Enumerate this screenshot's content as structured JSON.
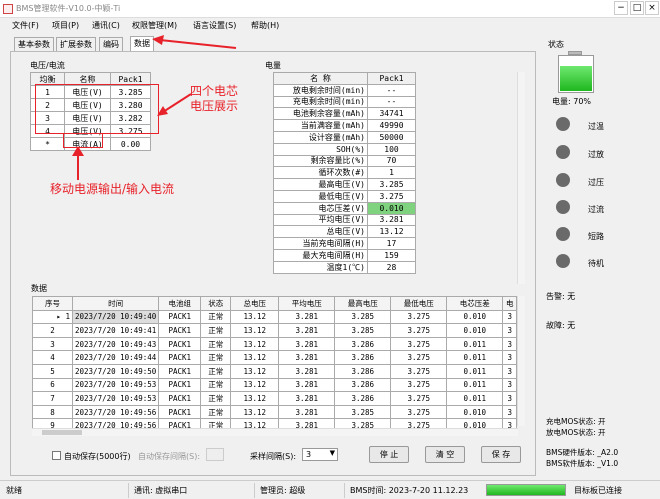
{
  "window": {
    "title": "BMS管理软件-V10.0-中颖-Ti"
  },
  "menu": [
    "文件(F)",
    "项目(P)",
    "通讯(C)",
    "权限管理(M)",
    "语言设置(S)",
    "帮助(H)"
  ],
  "tabs": [
    "基本参数",
    "扩展参数",
    "编码",
    "数据"
  ],
  "cells_section": {
    "title": "电压/电流",
    "headers": [
      "均衡",
      "名称",
      "Pack1"
    ],
    "rows": [
      [
        "1",
        "电压(V)",
        "3.285"
      ],
      [
        "2",
        "电压(V)",
        "3.280"
      ],
      [
        "3",
        "电压(V)",
        "3.282"
      ],
      [
        "4",
        "电压(V)",
        "3.275"
      ],
      [
        "*",
        "电流(A)",
        "0.00"
      ]
    ]
  },
  "quantity_section": {
    "title": "电量",
    "headers": [
      "名 称",
      "Pack1"
    ],
    "rows": [
      [
        "放电剩余时间(min)",
        "--"
      ],
      [
        "充电剩余时间(min)",
        "--"
      ],
      [
        "电池剩余容量(mAh)",
        "34741"
      ],
      [
        "当前满容量(mAh)",
        "49990"
      ],
      [
        "设计容量(mAh)",
        "50000"
      ],
      [
        "SOH(%)",
        "100"
      ],
      [
        "剩余容量比(%)",
        "70"
      ],
      [
        "循环次数(#)",
        "1"
      ],
      [
        "最高电压(V)",
        "3.285"
      ],
      [
        "最低电压(V)",
        "3.275"
      ],
      [
        "电芯压差(V)",
        "0.010"
      ],
      [
        "平均电压(V)",
        "3.281"
      ],
      [
        "总电压(V)",
        "13.12"
      ],
      [
        "当前充电间隔(H)",
        "17"
      ],
      [
        "最大充电间隔(H)",
        "159"
      ],
      [
        "温度1(℃)",
        "28"
      ]
    ],
    "highlight_row": 10
  },
  "data_section": {
    "title": "数据",
    "headers": [
      "序号",
      "时间",
      "电池组",
      "状态",
      "总电压",
      "平均电压",
      "最高电压",
      "最低电压",
      "电芯压差",
      "电"
    ],
    "rows": [
      [
        "1",
        "2023/7/20 10:49:40",
        "PACK1",
        "正常",
        "13.12",
        "3.281",
        "3.285",
        "3.275",
        "0.010",
        "3"
      ],
      [
        "2",
        "2023/7/20 10:49:41",
        "PACK1",
        "正常",
        "13.12",
        "3.281",
        "3.285",
        "3.275",
        "0.010",
        "3"
      ],
      [
        "3",
        "2023/7/20 10:49:43",
        "PACK1",
        "正常",
        "13.12",
        "3.281",
        "3.286",
        "3.275",
        "0.011",
        "3"
      ],
      [
        "4",
        "2023/7/20 10:49:44",
        "PACK1",
        "正常",
        "13.12",
        "3.281",
        "3.286",
        "3.275",
        "0.011",
        "3"
      ],
      [
        "5",
        "2023/7/20 10:49:50",
        "PACK1",
        "正常",
        "13.12",
        "3.281",
        "3.286",
        "3.275",
        "0.011",
        "3"
      ],
      [
        "6",
        "2023/7/20 10:49:53",
        "PACK1",
        "正常",
        "13.12",
        "3.281",
        "3.286",
        "3.275",
        "0.011",
        "3"
      ],
      [
        "7",
        "2023/7/20 10:49:53",
        "PACK1",
        "正常",
        "13.12",
        "3.281",
        "3.286",
        "3.275",
        "0.011",
        "3"
      ],
      [
        "8",
        "2023/7/20 10:49:56",
        "PACK1",
        "正常",
        "13.12",
        "3.281",
        "3.285",
        "3.275",
        "0.010",
        "3"
      ],
      [
        "9",
        "2023/7/20 10:49:56",
        "PACK1",
        "正常",
        "13.12",
        "3.281",
        "3.285",
        "3.275",
        "0.010",
        "3"
      ]
    ]
  },
  "bottom_controls": {
    "autosave_label": "自动保存(5000行)",
    "autosave_interval_label": "自动保存间隔(S):",
    "sample_interval_label": "采样间隔(S):",
    "sample_interval_value": "3",
    "stop_label": "停 止",
    "clear_label": "清 空",
    "save_label": "保 存"
  },
  "annotations": {
    "cells": "四个电芯电压展示",
    "cells_line1": "四个电芯",
    "cells_line2": "电压展示",
    "current": "移动电源输出/输入电流"
  },
  "status_panel": {
    "title": "状态",
    "charge_label": "电量: 70%",
    "charge_level": 0.7,
    "lamps": [
      "过温",
      "过放",
      "过压",
      "过流",
      "短路",
      "待机"
    ],
    "alarm": "告警: 无",
    "fault": "故障: 无",
    "charge_mos": "充电MOS状态: 开",
    "discharge_mos": "放电MOS状态: 开",
    "hw_version": "BMS硬件版本: _A2.0",
    "sw_version": "BMS软件版本: _V1.0"
  },
  "statusbar": {
    "ready": "就绪",
    "comm": "通讯: 虚拟串口",
    "admin": "管理员: 超级",
    "bms_time": "BMS时间: 2023-7-20 11.12.23",
    "board": "目标板已连接"
  },
  "colors": {
    "accent_green": "#2ecc40",
    "annotation_red": "#e8222a",
    "highlight": "#7fd37f"
  }
}
